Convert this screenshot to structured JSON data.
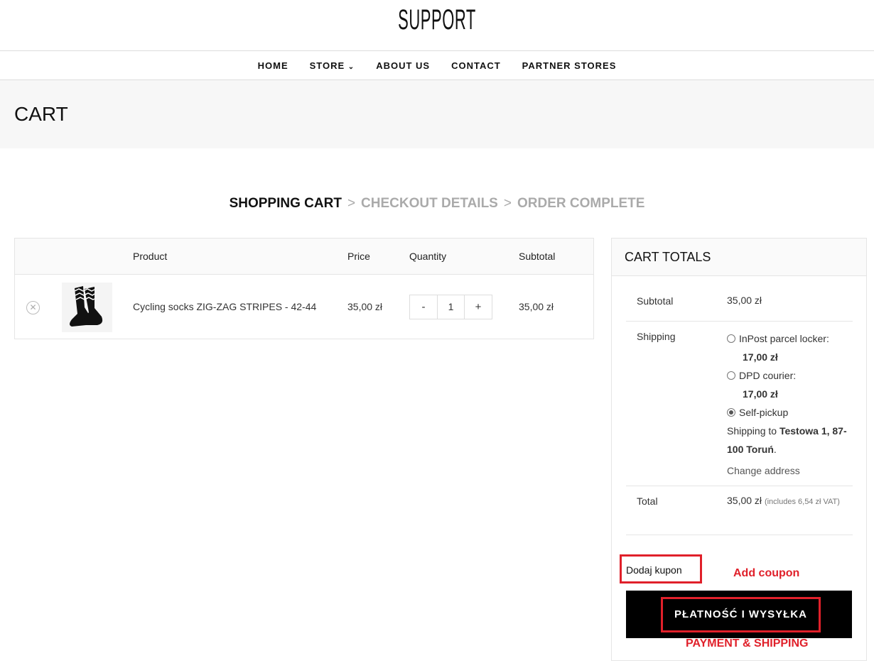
{
  "logo": "SUPPORT",
  "nav": [
    "HOME",
    "STORE",
    "ABOUT US",
    "CONTACT",
    "PARTNER STORES"
  ],
  "page_title": "CART",
  "steps": [
    "SHOPPING CART",
    "CHECKOUT DETAILS",
    "ORDER COMPLETE"
  ],
  "cart": {
    "headers": [
      "Product",
      "Price",
      "Quantity",
      "Subtotal"
    ],
    "item": {
      "name": "Cycling socks ZIG-ZAG STRIPES - 42-44",
      "price": "35,00 zł",
      "qty": "1",
      "subtotal": "35,00 zł"
    }
  },
  "totals": {
    "title": "CART TOTALS",
    "subtotal_label": "Subtotal",
    "subtotal": "35,00 zł",
    "shipping_label": "Shipping",
    "options": [
      {
        "label": "InPost parcel locker:",
        "price": "17,00 zł"
      },
      {
        "label": "DPD courier:",
        "price": "17,00 zł"
      },
      {
        "label": "Self-pickup",
        "selected": true
      }
    ],
    "ship_to_prefix": "Shipping to",
    "ship_to": "Testowa 1, 87-100 Toruń",
    "change_address": "Change address",
    "total_label": "Total",
    "total": "35,00 zł",
    "vat_note": "(includes 6,54 zł VAT)"
  },
  "coupon": "Dodaj kupon",
  "checkout_button": "PŁATNOŚĆ I WYSYŁKA",
  "annotations": {
    "coupon": "Add coupon",
    "checkout": "PAYMENT & SHIPPING"
  },
  "colors": {
    "annotation": "#e0202a"
  }
}
